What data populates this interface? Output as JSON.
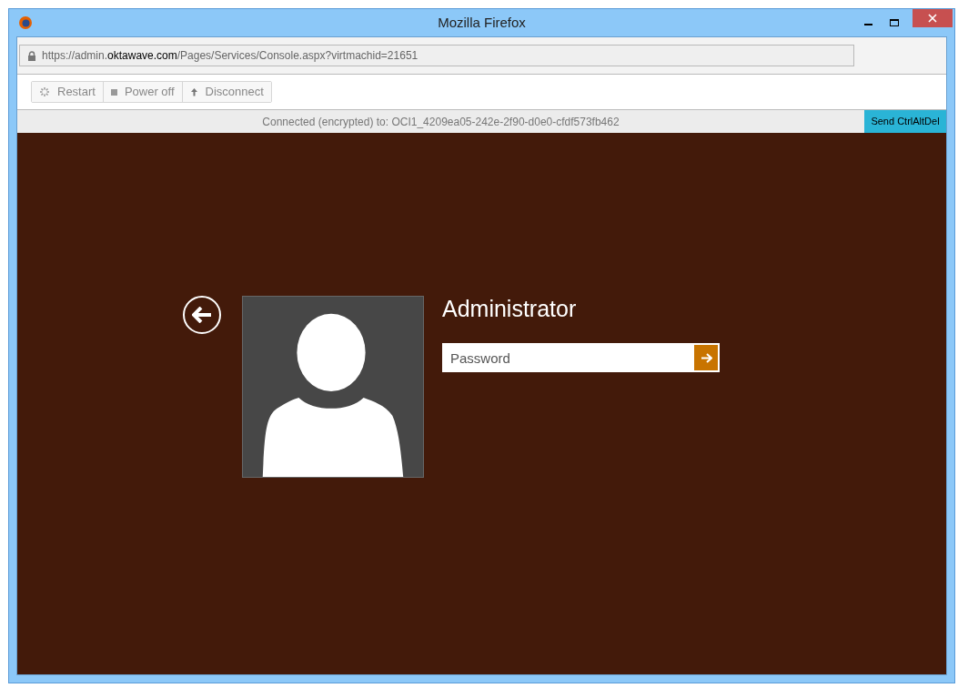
{
  "window": {
    "title": "Mozilla Firefox"
  },
  "address_bar": {
    "url": "https://admin.**oktawave.com**/Pages/Services/Console.aspx?virtmachid=21651"
  },
  "toolbar": {
    "buttons": [
      {
        "label": "Restart",
        "kind": "spinner"
      },
      {
        "label": "Power off",
        "kind": "stop"
      },
      {
        "label": "Disconnect",
        "kind": "up"
      }
    ]
  },
  "status": {
    "text": "Connected (encrypted) to: OCI1_4209ea05-242e-2f90-d0e0-cfdf573fb462",
    "button": "Send CtrlAltDel"
  },
  "login": {
    "user_name": "Administrator",
    "password": {
      "placeholder": "Password"
    }
  }
}
